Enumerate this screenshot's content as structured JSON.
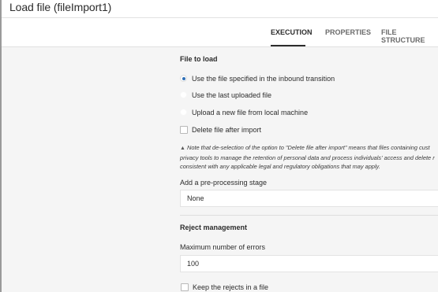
{
  "window": {
    "title": "Load file (fileImport1)"
  },
  "tabs": [
    {
      "label": "EXECUTION",
      "active": true
    },
    {
      "label": "PROPERTIES",
      "active": false
    },
    {
      "label": "FILE STRUCTURE",
      "active": false
    }
  ],
  "file_to_load": {
    "heading": "File to load",
    "options": [
      {
        "label": "Use the file specified in the inbound transition",
        "checked": true
      },
      {
        "label": "Use the last uploaded file",
        "checked": false
      },
      {
        "label": "Upload a new file from local machine",
        "checked": false
      }
    ],
    "delete_after_import": {
      "label": "Delete file after import",
      "checked": false
    },
    "note": {
      "lines": [
        "Note that de-selection of the option to \"Delete file after import\" means that files containing cust",
        "privacy tools to manage the retention of personal data and process individuals' access and delete r",
        "consistent with any applicable legal and regulatory obligations that may apply."
      ]
    }
  },
  "preprocessing": {
    "label": "Add a pre-processing stage",
    "value": "None"
  },
  "reject_management": {
    "heading": "Reject management",
    "max_errors_label": "Maximum number of errors",
    "max_errors_value": "100",
    "keep_rejects": {
      "label": "Keep the rejects in a file",
      "checked": false
    }
  },
  "colors": {
    "accent": "#2f6fb6",
    "panel_bg": "#f5f5f5",
    "text": "#2c2c2c"
  }
}
